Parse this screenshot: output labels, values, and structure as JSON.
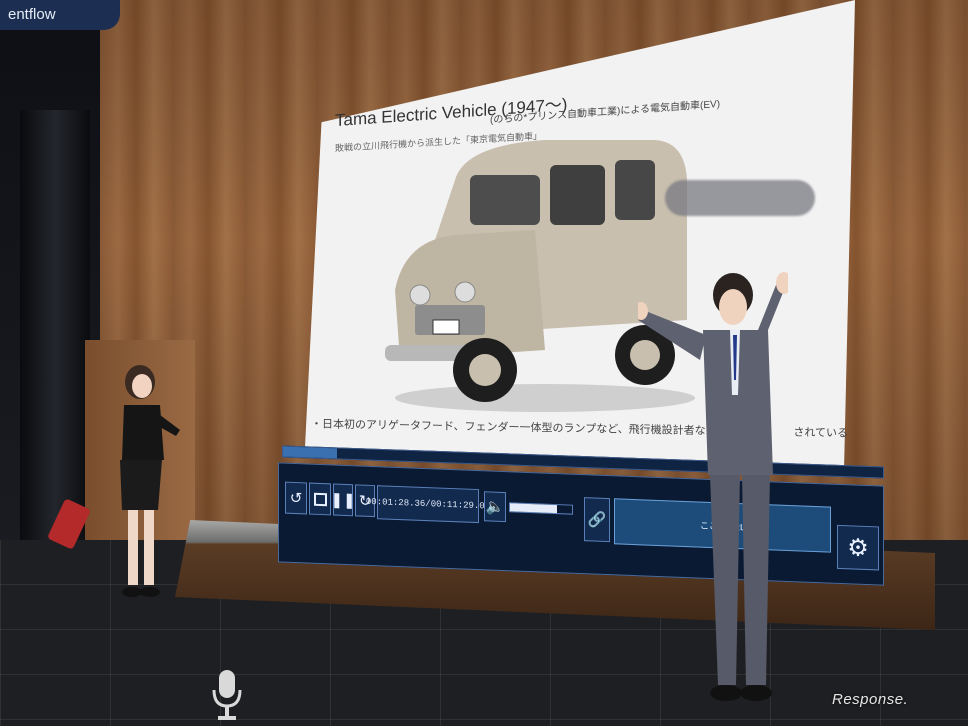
{
  "header": {
    "brand_label": "entflow"
  },
  "slide": {
    "title": "Tama Electric Vehicle (1947〜)",
    "subtitle_left": "敗戦の立川飛行機から派生した「東京電気自動車」",
    "subtitle": "(のちの*プリンス自動車工業)による電気自動車(EV)",
    "bullet": "・日本初のアリゲータフード、フェンダー一体型のランプなど、飛行機設計者ならではの　　　　されている",
    "redacted_caption": ""
  },
  "player": {
    "progress_fraction": 0.09,
    "timecode": "00:01:28.36/00:11:29.06",
    "volume_fraction": 0.75,
    "url_placeholder": "ここにURL",
    "buttons": {
      "rewind_icon": "rewind-icon",
      "stop_icon": "stop-icon",
      "pause_icon": "pause-icon",
      "forward_icon": "forward-icon",
      "speaker_icon": "speaker-icon",
      "link_icon": "link-icon",
      "settings_icon": "gear-icon"
    }
  },
  "mic": {
    "icon": "microphone-icon"
  },
  "watermark": {
    "text": "Response."
  },
  "colors": {
    "panel_bg": "#0b1a33",
    "panel_border": "#4a6a9c",
    "accent": "#1d4b7a",
    "wood": "#9c6a43"
  }
}
